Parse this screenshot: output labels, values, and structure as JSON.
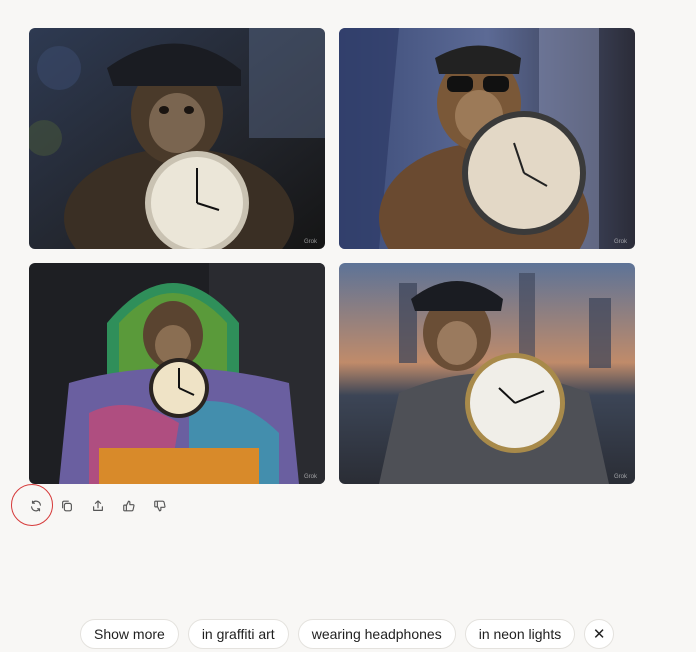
{
  "images": [
    {
      "alt": "monkey in cap holding clock with graffiti background",
      "watermark": "Grok"
    },
    {
      "alt": "monkey with bandana and sunglasses holding clock",
      "watermark": "Grok"
    },
    {
      "alt": "monkey in rainbow hoodie holding alarm clock",
      "watermark": "Grok"
    },
    {
      "alt": "monkey in grey hoodie holding wall clock at dusk",
      "watermark": "Grok"
    }
  ],
  "actions": [
    "refresh-icon",
    "copy-icon",
    "share-icon",
    "thumbs-up-icon",
    "thumbs-down-icon"
  ],
  "suggestions": [
    {
      "label": "Show more"
    },
    {
      "label": "in graffiti art"
    },
    {
      "label": "wearing headphones"
    },
    {
      "label": "in neon lights"
    }
  ],
  "close_glyph": "✕",
  "colors": {
    "background": "#f8f7f5",
    "highlight_ring": "#d63a3a"
  }
}
